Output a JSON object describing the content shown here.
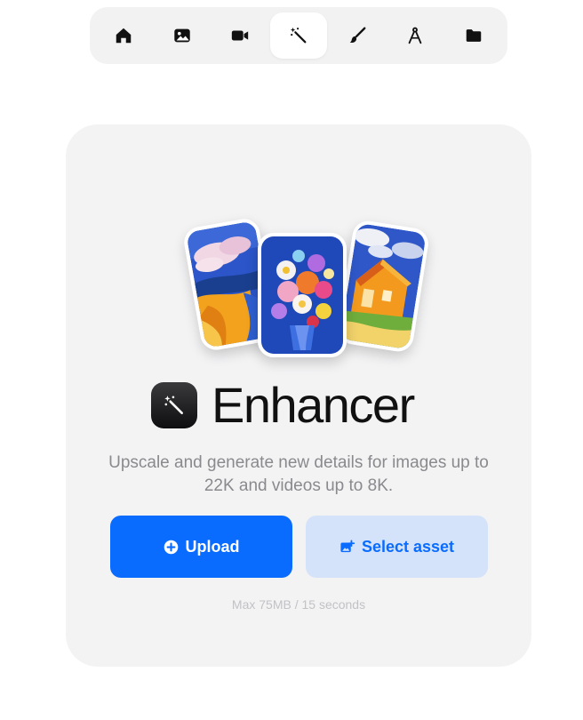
{
  "toolbar": {
    "items": [
      {
        "icon": "home-icon",
        "active": false
      },
      {
        "icon": "image-icon",
        "active": false
      },
      {
        "icon": "video-icon",
        "active": false
      },
      {
        "icon": "magic-wand-icon",
        "active": true
      },
      {
        "icon": "brush-icon",
        "active": false
      },
      {
        "icon": "compass-icon",
        "active": false
      },
      {
        "icon": "folder-icon",
        "active": false
      }
    ]
  },
  "main": {
    "title": "Enhancer",
    "subtitle": "Upscale and generate new details for images up to 22K and videos up to 8K.",
    "upload_label": "Upload",
    "select_label": "Select asset",
    "note": "Max 75MB / 15 seconds"
  },
  "colors": {
    "accent": "#0a6cff",
    "secondary_button_bg": "#d5e3fa",
    "card_bg": "#f3f3f4",
    "toolbar_bg": "#f2f2f3"
  }
}
